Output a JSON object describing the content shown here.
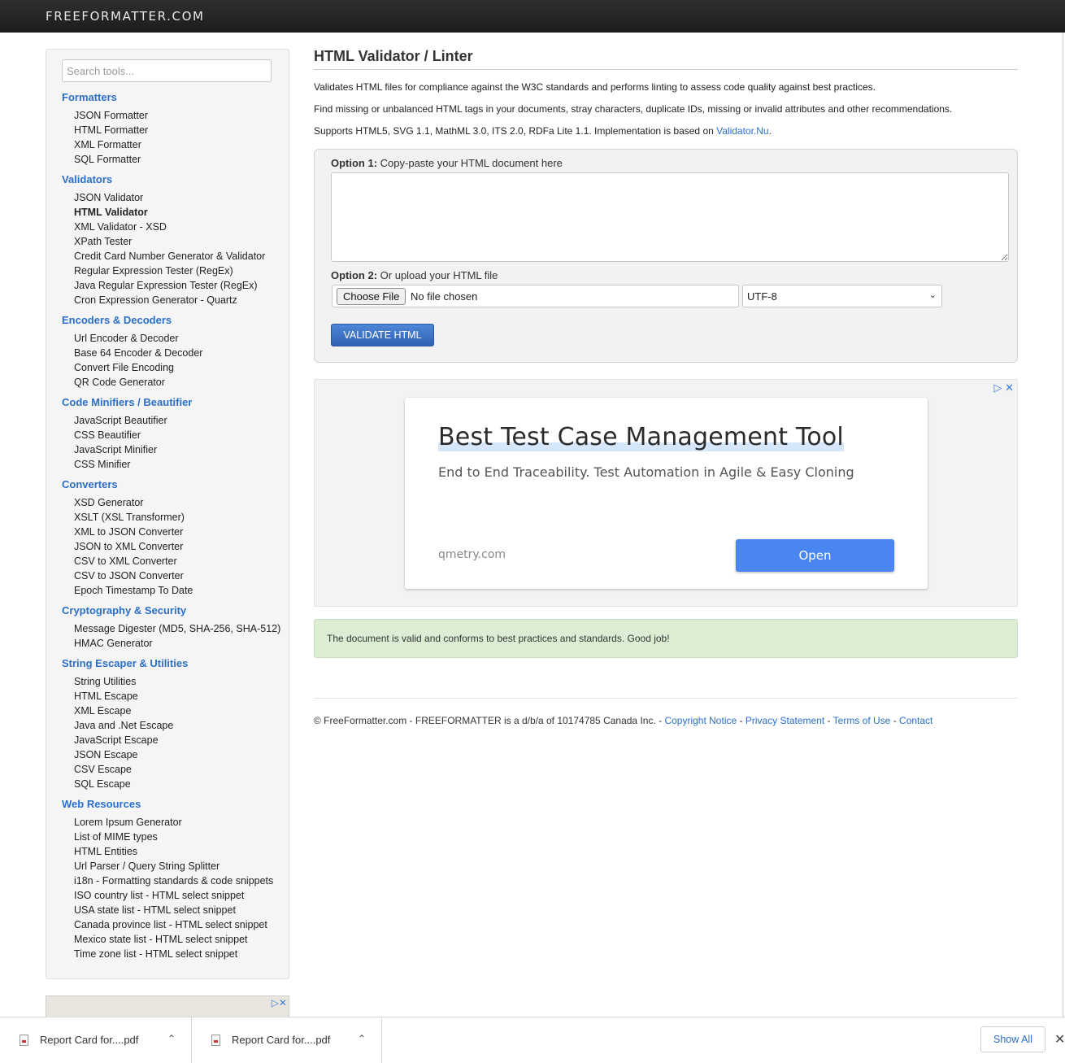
{
  "header": {
    "brand": "FREEFORMATTER.COM"
  },
  "sidebar": {
    "search_placeholder": "Search tools...",
    "categories": [
      {
        "title": "Formatters",
        "items": [
          "JSON Formatter",
          "HTML Formatter",
          "XML Formatter",
          "SQL Formatter"
        ]
      },
      {
        "title": "Validators",
        "items": [
          "JSON Validator",
          "HTML Validator",
          "XML Validator - XSD",
          "XPath Tester",
          "Credit Card Number Generator & Validator",
          "Regular Expression Tester (RegEx)",
          "Java Regular Expression Tester (RegEx)",
          "Cron Expression Generator - Quartz"
        ]
      },
      {
        "title": "Encoders & Decoders",
        "items": [
          "Url Encoder & Decoder",
          "Base 64 Encoder & Decoder",
          "Convert File Encoding",
          "QR Code Generator"
        ]
      },
      {
        "title": "Code Minifiers / Beautifier",
        "items": [
          "JavaScript Beautifier",
          "CSS Beautifier",
          "JavaScript Minifier",
          "CSS Minifier"
        ]
      },
      {
        "title": "Converters",
        "items": [
          "XSD Generator",
          "XSLT (XSL Transformer)",
          "XML to JSON Converter",
          "JSON to XML Converter",
          "CSV to XML Converter",
          "CSV to JSON Converter",
          "Epoch Timestamp To Date"
        ]
      },
      {
        "title": "Cryptography & Security",
        "items": [
          "Message Digester (MD5, SHA-256, SHA-512)",
          "HMAC Generator"
        ]
      },
      {
        "title": "String Escaper & Utilities",
        "items": [
          "String Utilities",
          "HTML Escape",
          "XML Escape",
          "Java and .Net Escape",
          "JavaScript Escape",
          "JSON Escape",
          "CSV Escape",
          "SQL Escape"
        ]
      },
      {
        "title": "Web Resources",
        "items": [
          "Lorem Ipsum Generator",
          "List of MIME types",
          "HTML Entities",
          "Url Parser / Query String Splitter",
          "i18n - Formatting standards & code snippets",
          "ISO country list - HTML select snippet",
          "USA state list - HTML select snippet",
          "Canada province list - HTML select snippet",
          "Mexico state list - HTML select snippet",
          "Time zone list - HTML select snippet"
        ]
      }
    ],
    "active_item": "HTML Validator"
  },
  "main": {
    "title": "HTML Validator / Linter",
    "desc1": "Validates HTML files for compliance against the W3C standards and performs linting to assess code quality against best practices.",
    "desc2": "Find missing or unbalanced HTML tags in your documents, stray characters, duplicate IDs, missing or invalid attributes and other recommendations.",
    "desc3_prefix": "Supports HTML5, SVG 1.1, MathML 3.0, ITS 2.0, RDFa Lite 1.1. Implementation is based on ",
    "desc3_link": "Validator.Nu",
    "desc3_suffix": ".",
    "option1_bold": "Option 1:",
    "option1_text": " Copy-paste your HTML document here",
    "option2_bold": "Option 2:",
    "option2_text": " Or upload your HTML file",
    "choose_file": "Choose File",
    "no_file": "No file chosen",
    "encoding": "UTF-8",
    "validate_button": "VALIDATE HTML",
    "success_message": "The document is valid and conforms to best practices and standards. Good job!"
  },
  "ad": {
    "title": "Best Test Case Management Tool",
    "subtitle": "End to End Traceability. Test Automation in Agile & Easy Cloning",
    "domain": "qmetry.com",
    "button": "Open"
  },
  "footer": {
    "text": "© FreeFormatter.com - FREEFORMATTER is a d/b/a of 10174785 Canada Inc. - ",
    "links": [
      "Copyright Notice",
      "Privacy Statement",
      "Terms of Use",
      "Contact"
    ]
  },
  "downloads": {
    "items": [
      "Report Card for....pdf",
      "Report Card for....pdf"
    ],
    "show_all": "Show All"
  }
}
